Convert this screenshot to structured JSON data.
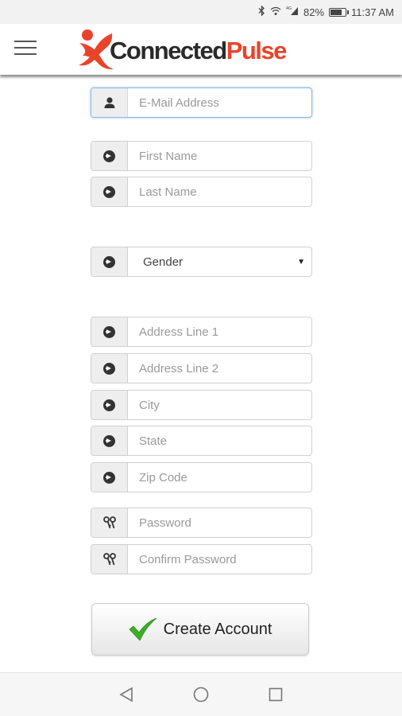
{
  "status_bar": {
    "battery": "82%",
    "time": "11:37 AM",
    "icons": [
      "bluetooth-icon",
      "wifi-icon",
      "4g-signal-icon",
      "battery-icon"
    ]
  },
  "app_bar": {
    "logo_text_part1": "Connected",
    "logo_text_part2": "Pulse",
    "brand_color": "#e8442a",
    "menu_icon": "hamburger-menu-icon"
  },
  "form": {
    "email": {
      "placeholder": "E-Mail Address",
      "value": "",
      "icon": "user-icon"
    },
    "first_name": {
      "placeholder": "First Name",
      "value": "",
      "icon": "arrow-circle-icon"
    },
    "last_name": {
      "placeholder": "Last Name",
      "value": "",
      "icon": "arrow-circle-icon"
    },
    "gender": {
      "selected": "Gender",
      "icon": "arrow-circle-icon"
    },
    "address1": {
      "placeholder": "Address Line 1",
      "value": "",
      "icon": "arrow-circle-icon"
    },
    "address2": {
      "placeholder": "Address Line 2",
      "value": "",
      "icon": "arrow-circle-icon"
    },
    "city": {
      "placeholder": "City",
      "value": "",
      "icon": "arrow-circle-icon"
    },
    "state": {
      "placeholder": "State",
      "value": "",
      "icon": "arrow-circle-icon"
    },
    "zip": {
      "placeholder": "Zip Code",
      "value": "",
      "icon": "arrow-circle-icon"
    },
    "password": {
      "placeholder": "Password",
      "value": "",
      "icon": "keys-icon"
    },
    "confirm_password": {
      "placeholder": "Confirm Password",
      "value": "",
      "icon": "keys-icon"
    },
    "submit_label": "Create Account",
    "submit_icon": "checkmark-icon",
    "checkmark_color": "#3fae2a"
  },
  "nav_bar": {
    "icons": [
      "back-triangle-icon",
      "home-circle-icon",
      "recents-square-icon"
    ]
  }
}
